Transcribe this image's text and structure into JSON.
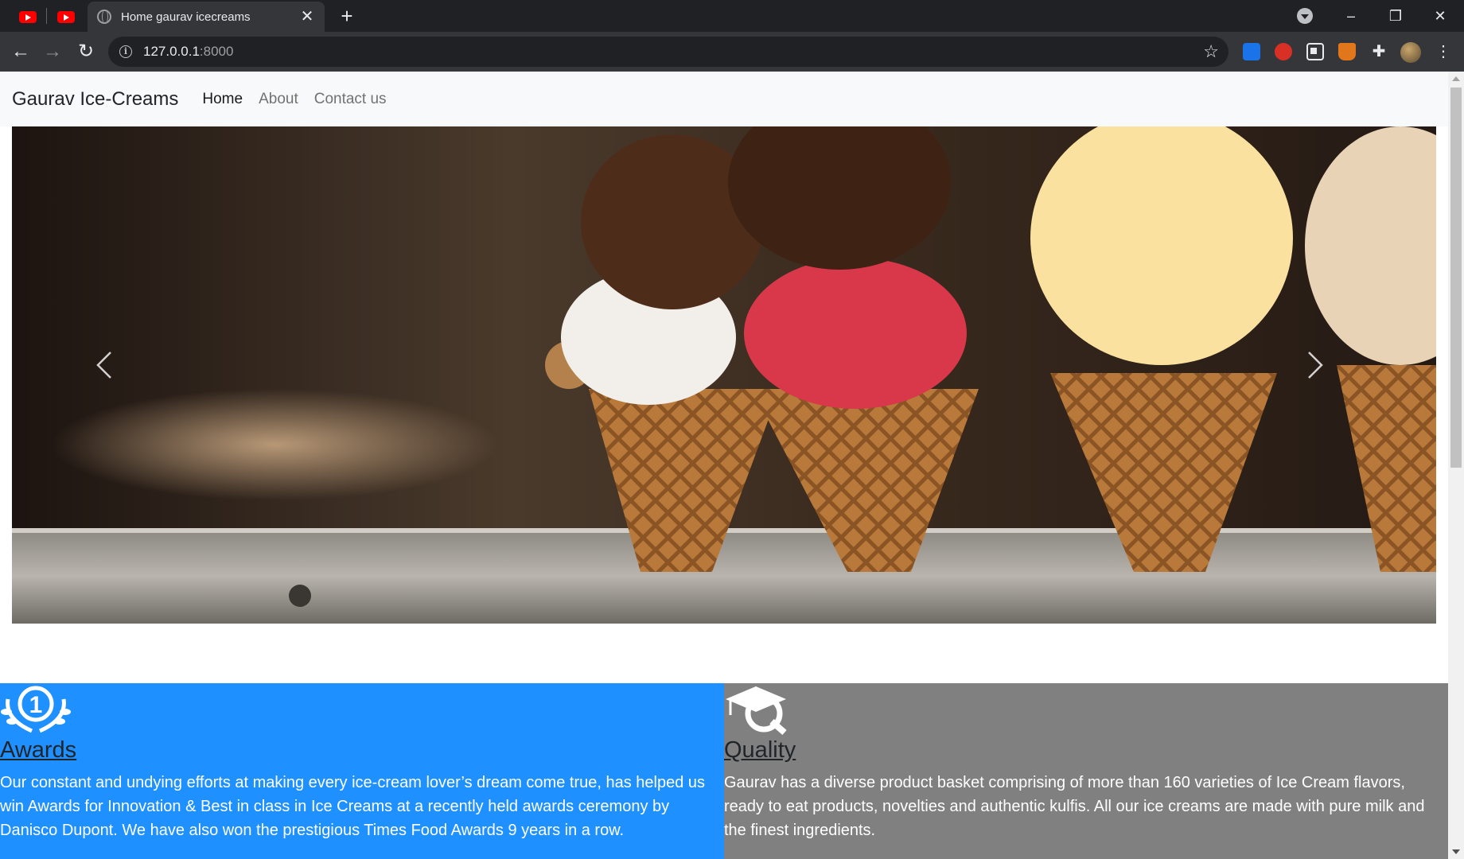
{
  "browser": {
    "pinned_tabs": [
      {
        "icon": "youtube-icon"
      },
      {
        "icon": "youtube-icon"
      }
    ],
    "active_tab": {
      "title": "Home gaurav icecreams",
      "icon": "globe-icon",
      "close": "✕"
    },
    "new_tab": "+",
    "window_controls": {
      "minimize": "–",
      "restore": "❐",
      "close": "✕"
    },
    "address_bar": {
      "host": "127.0.0.1",
      "port": ":8000",
      "info_icon": "i"
    },
    "star": "☆",
    "extensions_icon": "✚",
    "menu": "⋮",
    "back": "←",
    "forward": "→",
    "reload": "↻"
  },
  "site": {
    "brand": "Gaurav Ice-Creams",
    "nav": [
      {
        "label": "Home",
        "active": true
      },
      {
        "label": "About",
        "active": false
      },
      {
        "label": "Contact us",
        "active": false
      }
    ]
  },
  "carousel": {
    "prev": "‹",
    "next": "›",
    "image": "ice-cream-cones-photo"
  },
  "features": [
    {
      "icon": "award-laurel-icon",
      "heading": "Awards",
      "text": "Our constant and undying efforts at making every ice-cream lover’s dream come true, has helped us win Awards for Innovation & Best in class in Ice Creams at a recently held awards ceremony by Danisco Dupont. We have also won the prestigious Times Food Awards 9 years in a row.",
      "color": "#1e90ff"
    },
    {
      "icon": "quality-cap-icon",
      "heading": "Quality",
      "text": "Gaurav has a diverse product basket comprising of more than 160 varieties of Ice Cream flavors, ready to eat products, novelties and authentic kulfis. All our ice creams are made with pure milk and the finest ingredients.",
      "color": "#808080"
    }
  ]
}
